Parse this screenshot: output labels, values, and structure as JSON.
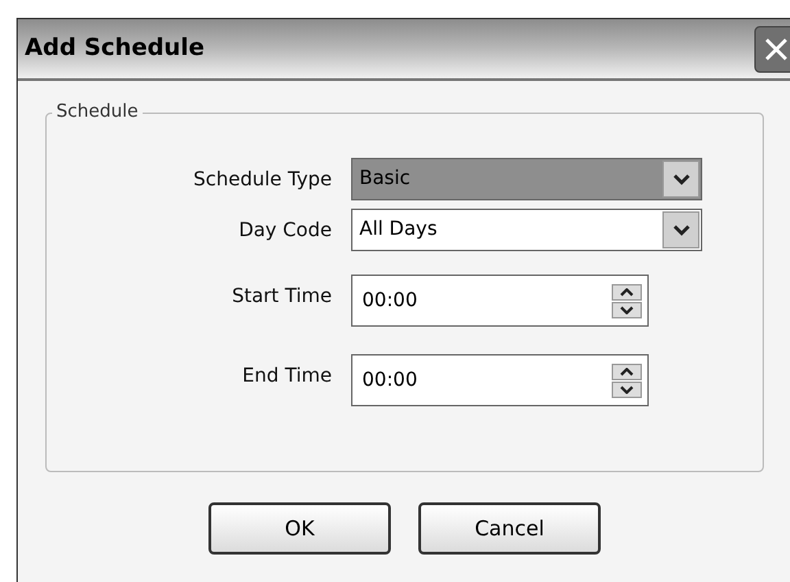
{
  "window": {
    "title": "Add Schedule"
  },
  "group": {
    "legend": "Schedule"
  },
  "fields": [
    {
      "kind": "dropdown",
      "label": "Schedule Type",
      "value": "Basic",
      "highlighted": true
    },
    {
      "kind": "dropdown",
      "label": "Day Code",
      "value": "All Days",
      "highlighted": false
    },
    {
      "kind": "spinner",
      "label": "Start Time",
      "value": "00:00",
      "highlighted": false
    },
    {
      "kind": "spinner",
      "label": "End Time",
      "value": "00:00",
      "highlighted": false
    }
  ],
  "buttons": [
    "OK",
    "Cancel"
  ]
}
